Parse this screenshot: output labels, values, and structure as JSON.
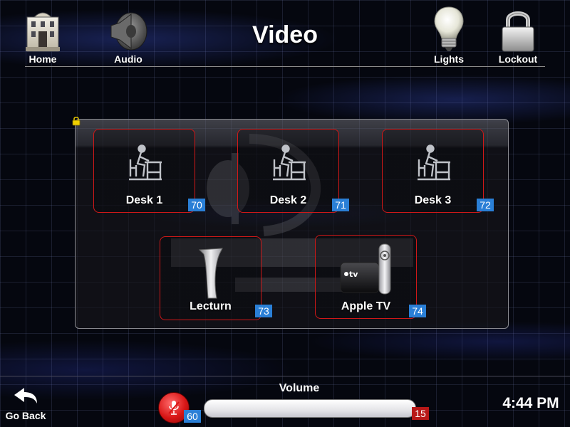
{
  "header": {
    "title": "Video",
    "nav": [
      {
        "label": "Home",
        "icon": "building-icon"
      },
      {
        "label": "Audio",
        "icon": "speaker-icon"
      },
      {
        "label": "Lights",
        "icon": "lightbulb-icon"
      },
      {
        "label": "Lockout",
        "icon": "padlock-icon"
      }
    ]
  },
  "sources": [
    {
      "label": "Desk 1",
      "badge": "70",
      "icon": "desk-icon"
    },
    {
      "label": "Desk 2",
      "badge": "71",
      "icon": "desk-icon"
    },
    {
      "label": "Desk 3",
      "badge": "72",
      "icon": "desk-icon"
    },
    {
      "label": "Lecturn",
      "badge": "73",
      "icon": "lectern-icon"
    },
    {
      "label": "Apple TV",
      "badge": "74",
      "icon": "apple-tv-icon"
    }
  ],
  "footer": {
    "go_back": "Go Back",
    "volume_label": "Volume",
    "mic_badge": "60",
    "volume_badge": "15",
    "clock": "4:44 PM"
  },
  "colors": {
    "tile_border": "#d01818",
    "badge_blue": "#2a7fd6",
    "badge_red": "#b81818",
    "mic_red": "#d81616"
  }
}
